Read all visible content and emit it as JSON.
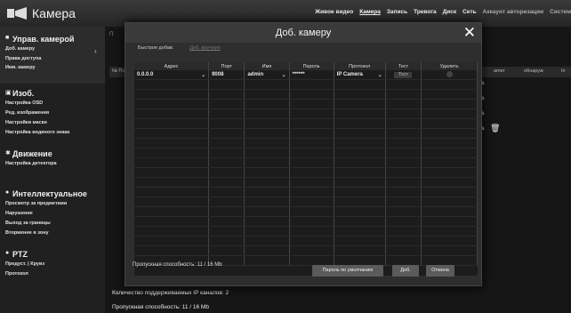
{
  "header": {
    "app_title": "Камера",
    "nav": [
      "Живое видео",
      "Камера",
      "Запись",
      "Тревога",
      "Диск",
      "Сеть",
      "Аккаунт авторизации",
      "Систем"
    ],
    "nav_active_index": 1
  },
  "sidebar": {
    "sections": [
      {
        "title": "Управ. камерой",
        "items": [
          "Доб. камеру",
          "Права доступа",
          "Имя. камеру"
        ]
      },
      {
        "title": "Изоб.",
        "items": [
          "Настройка OSD",
          "Ред. изображения",
          "Настройки маски",
          "Настройка водяного знака"
        ]
      },
      {
        "title": "Движение",
        "items": [
          "Настройка детектора"
        ]
      },
      {
        "title": "Интеллектуальное",
        "items": [
          "Просмотр за предметами",
          "Нарушение",
          "Выход за границы",
          "Вторжение в зону"
        ]
      },
      {
        "title": "PTZ",
        "items": [
          "Предуст. | Круиз",
          "Протокол"
        ]
      }
    ]
  },
  "background": {
    "tab": "П",
    "col_hint": "№ По",
    "right_cols": [
      "Имя",
      "Пароль",
      "Протокол"
    ],
    "right_hints": [
      "amer",
      "обнаруж",
      "In"
    ],
    "bottom": [
      "Количество поддерживаемых IP каналов: 2",
      "Пропускная способность: 11 / 16 Mb"
    ]
  },
  "modal": {
    "title": "Доб. камеру",
    "tabs": [
      "Быстрое добав.",
      "Доб. вручную"
    ],
    "columns": [
      "Адрес",
      "Порт",
      "Имя",
      "Пароль",
      "Протокол",
      "Тест",
      "Удалить"
    ],
    "row": {
      "address": "0.0.0.0",
      "port": "9008",
      "name": "admin",
      "password": "******",
      "protocol": "IP Camera",
      "test": "Тест"
    },
    "bandwidth": "Пропускная способность: 11 / 16 Mb",
    "buttons": {
      "default_password": "Пароль по умолчанию",
      "add": "Доб.",
      "cancel": "Отмена"
    }
  }
}
